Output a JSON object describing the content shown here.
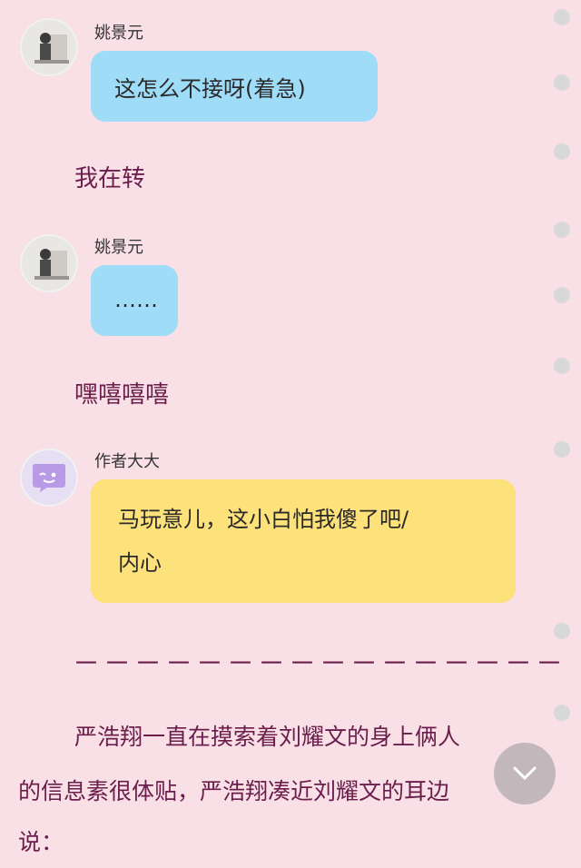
{
  "messages": [
    {
      "sender": "姚景元",
      "text": "这怎么不接呀(着急)"
    },
    {
      "sender": "姚景元",
      "text": "……"
    },
    {
      "sender": "作者大大",
      "lines": [
        "马玩意儿，这小白怕我傻了吧/",
        "内心"
      ]
    }
  ],
  "narration": [
    "我在转",
    "嘿嘻嘻嘻"
  ],
  "divider": "－－－－－－－－－－－－－－－－",
  "paragraph": {
    "line1": "严浩翔一直在摸索着刘耀文的身上俩人",
    "line2": "的信息素很体贴，严浩翔凑近刘耀文的耳边",
    "line3": "说："
  },
  "colors": {
    "background": "#f9dfe6",
    "bubble_blue": "#9fdcf8",
    "bubble_yellow": "#fde17a",
    "narration_text": "#6b1e4b"
  },
  "icons": {
    "scroll_down": "chevron-down-icon",
    "author_avatar": "chat-bubble-icon"
  }
}
